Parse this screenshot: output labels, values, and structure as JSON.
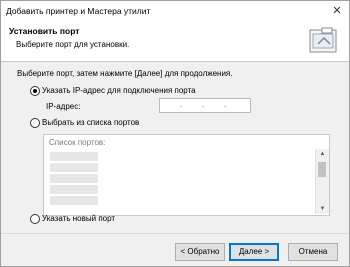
{
  "window": {
    "title": "Добавить принтер и Мастера утилит",
    "close_glyph": "✕"
  },
  "header": {
    "title": "Установить порт",
    "subtitle": "Выберите порт для установки."
  },
  "intro": "Выберите порт, затем нажмите [Далее] для продолжения.",
  "options": {
    "ip": {
      "label": "Указать IP-адрес для подключения порта",
      "selected": true
    },
    "ip_field_label": "IP-адрес:",
    "ip_value": "",
    "list": {
      "label": "Выбрать из списка портов",
      "selected": false
    },
    "new_port": {
      "label": "Указать новый порт",
      "selected": false
    }
  },
  "ports": {
    "caption": "Список портов:"
  },
  "buttons": {
    "back": "< Обратно",
    "next": "Далее >",
    "cancel": "Отмена"
  }
}
